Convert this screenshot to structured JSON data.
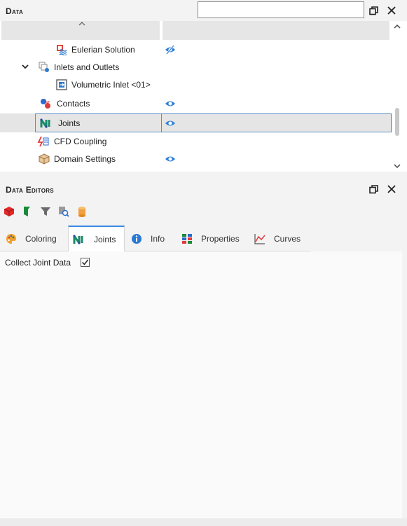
{
  "data_panel": {
    "title": "Data",
    "search": {
      "value": "",
      "placeholder": ""
    },
    "tree": [
      {
        "label": "Eulerian Solution",
        "icon": "eulerian-icon",
        "visible": "hidden-eye-icon"
      },
      {
        "label": "Inlets and Outlets",
        "icon": "inlets-outlets-icon",
        "expanded": true
      },
      {
        "label": "Volumetric Inlet <01>",
        "icon": "volumetric-inlet-icon"
      },
      {
        "label": "Contacts",
        "icon": "contacts-icon",
        "visible": "eye-icon"
      },
      {
        "label": "Joints",
        "icon": "joints-icon",
        "visible": "eye-icon",
        "selected": true
      },
      {
        "label": "CFD Coupling",
        "icon": "cfd-coupling-icon"
      },
      {
        "label": "Domain Settings",
        "icon": "domain-settings-icon",
        "visible": "eye-icon"
      }
    ]
  },
  "editors": {
    "title": "Data Editors",
    "toolbar": [
      "red-cube-icon",
      "green-flag-icon",
      "filter-icon",
      "search-doc-icon",
      "cylinder-icon"
    ],
    "tabs": [
      {
        "label": "Coloring",
        "icon": "palette-icon"
      },
      {
        "label": "Joints",
        "icon": "joints-icon",
        "active": true
      },
      {
        "label": "Info",
        "icon": "info-icon"
      },
      {
        "label": "Properties",
        "icon": "properties-icon"
      },
      {
        "label": "Curves",
        "icon": "curves-icon"
      }
    ],
    "collect_joint_data": {
      "label": "Collect Joint Data",
      "checked": true
    }
  },
  "colors": {
    "accent": "#3a8ae0",
    "selection_border": "#5a8fc4",
    "eye": "#2f7fd6"
  }
}
